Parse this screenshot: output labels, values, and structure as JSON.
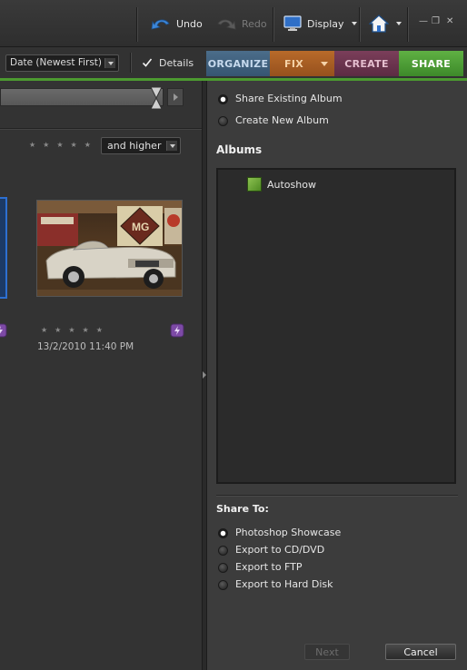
{
  "toolbar": {
    "undo_label": "Undo",
    "redo_label": "Redo",
    "display_label": "Display",
    "home_icon": "home-icon"
  },
  "browser": {
    "sort_value": "Date (Newest First)",
    "details_label": "Details",
    "details_checked": true,
    "rating_filter": "and higher",
    "rating_filter_stars": 0,
    "photo": {
      "date": "13/2/2010 11:40 PM",
      "rating": 0
    }
  },
  "tabs": {
    "organize": "ORGANIZE",
    "fix": "FIX",
    "create": "CREATE",
    "share": "SHARE",
    "active": "SHARE"
  },
  "share_panel": {
    "album_options": [
      {
        "label": "Share Existing Album",
        "selected": true
      },
      {
        "label": "Create New Album",
        "selected": false
      }
    ],
    "albums_title": "Albums",
    "albums": [
      "Autoshow"
    ],
    "share_to_title": "Share To:",
    "share_to_options": [
      {
        "label": "Photoshop Showcase",
        "selected": true
      },
      {
        "label": "Export to CD/DVD",
        "selected": false
      },
      {
        "label": "Export to FTP",
        "selected": false
      },
      {
        "label": "Export to Hard Disk",
        "selected": false
      }
    ],
    "next_label": "Next",
    "cancel_label": "Cancel"
  },
  "colors": {
    "organize": "#416281",
    "fix": "#a85f25",
    "create": "#6c344e",
    "share": "#4f9d36"
  }
}
